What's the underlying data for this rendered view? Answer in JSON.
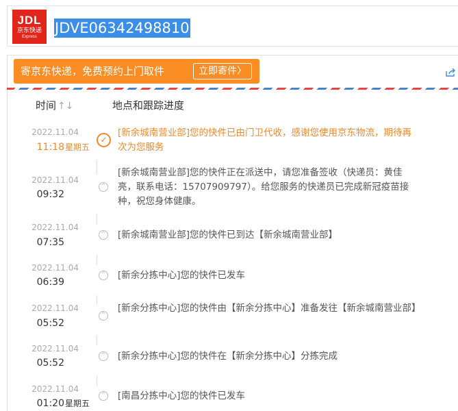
{
  "header": {
    "logo": {
      "line1": "JDL",
      "line2": "京东快递",
      "line3": "Express"
    },
    "tracking_number": "JDVE06342498810"
  },
  "banner": {
    "text": "寄京东快递，免费预约上门取件",
    "button_label": "立即寄件",
    "button_arrow": "〉"
  },
  "share_icon": "share-icon",
  "table": {
    "col_time": "时间",
    "sort_icon": "↑↓",
    "col_detail": "地点和跟踪进度"
  },
  "events": [
    {
      "date": "2022.11.04",
      "time": "11:18",
      "weekday": "星期五",
      "desc": "[新余城南营业部]您的快件已由门卫代收，感谢您使用京东物流，期待再次为您服务",
      "icon": "check-circle-icon"
    },
    {
      "date": "2022.11.04",
      "time": "09:32",
      "weekday": "",
      "desc": "[新余城南营业部]您的快件正在派送中，请您准备签收（快递员：黄佳亮，联系电话：15707909797）。给您服务的快递员已完成新冠疫苗接种，祝您身体健康。",
      "icon": "chevron-up-circle-icon"
    },
    {
      "date": "2022.11.04",
      "time": "07:35",
      "weekday": "",
      "desc": "[新余城南营业部]您的快件已到达【新余城南营业部】",
      "icon": "chevron-up-circle-icon"
    },
    {
      "date": "2022.11.04",
      "time": "06:39",
      "weekday": "",
      "desc": "[新余分拣中心]您的快件已发车",
      "icon": "chevron-up-circle-icon"
    },
    {
      "date": "2022.11.04",
      "time": "05:52",
      "weekday": "",
      "desc": "[新余分拣中心]您的快件由【新余分拣中心】准备发往【新余城南营业部】",
      "icon": "chevron-up-circle-icon"
    },
    {
      "date": "2022.11.04",
      "time": "05:52",
      "weekday": "",
      "desc": "[新余分拣中心]您的快件在【新余分拣中心】分拣完成",
      "icon": "chevron-up-circle-icon"
    },
    {
      "date": "2022.11.04",
      "time": "01:20",
      "weekday": "星期五",
      "desc": "[南昌分拣中心]您的快件已发车",
      "icon": "chevron-up-circle-icon"
    }
  ],
  "colors": {
    "brand_red": "#e1251b",
    "accent_orange": "#f98c22",
    "selection_blue": "#3a8ee6",
    "active_text": "#f0892a"
  }
}
